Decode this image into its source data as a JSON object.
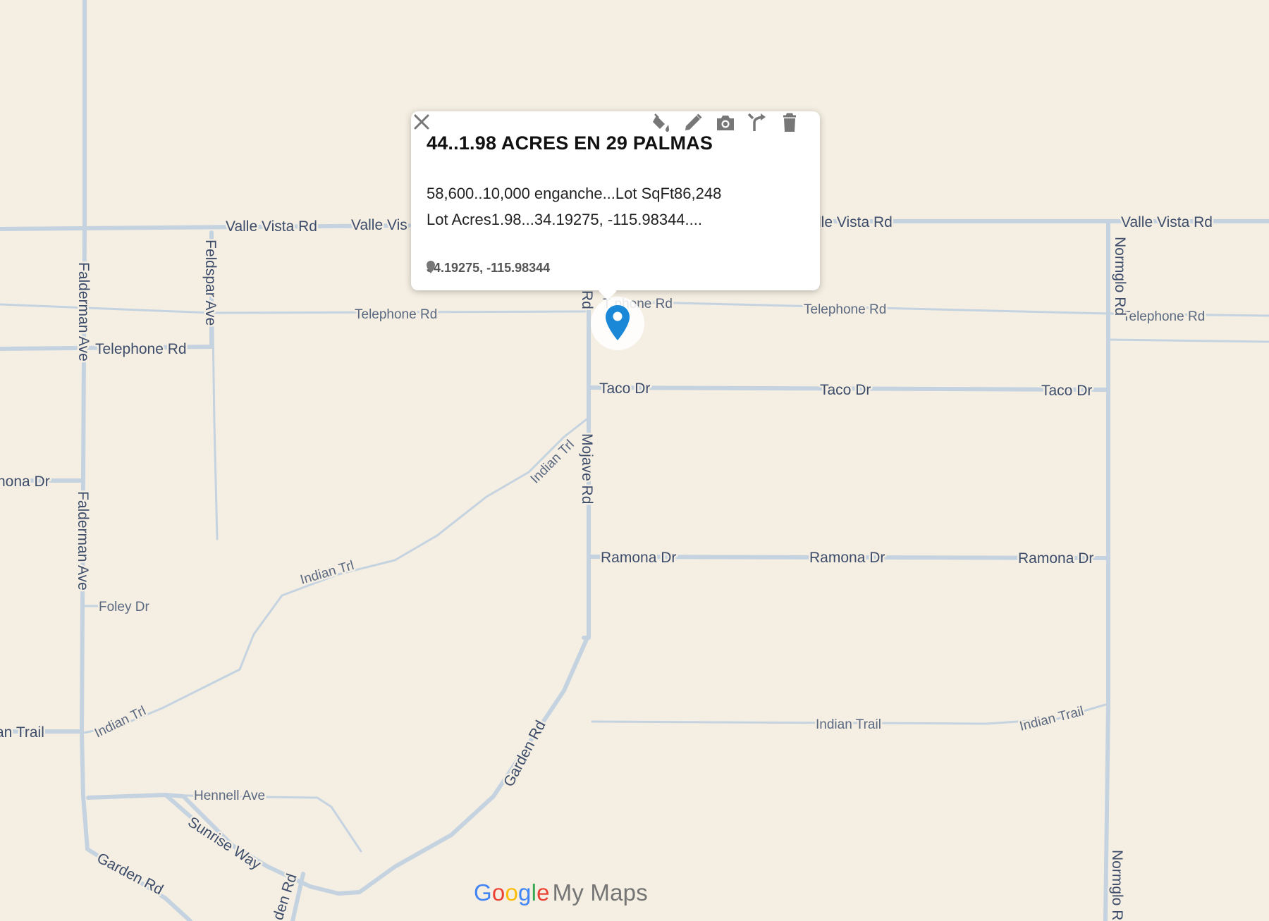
{
  "popup": {
    "title": "44..1.98 ACRES EN 29 PALMAS",
    "description_line1": "58,600..10,000 enganche...Lot SqFt86,248",
    "description_line2": "Lot Acres1.98...34.19275, -115.98344....",
    "coordinates": "34.19275, -115.98344",
    "close_icon": "close-icon",
    "tools": [
      "paint-bucket-icon",
      "edit-pencil-icon",
      "camera-icon",
      "directions-icon",
      "trash-icon"
    ]
  },
  "marker": {
    "color": "#1a88d6",
    "icon": "map-pin-icon"
  },
  "roads": {
    "valle_vista": [
      "Valle Vista Rd",
      "Valle Vis",
      "lle Vista Rd",
      "Valle Vista Rd"
    ],
    "telephone": [
      "Telephone Rd",
      "Telephone Rd",
      "Telephone Rd",
      "Telephone Rd",
      "Telephone Rd"
    ],
    "telephone_partial": "T  phone Rd",
    "taco": [
      "Taco Dr",
      "Taco Dr",
      "Taco Dr"
    ],
    "ramona": [
      "Ramona Dr",
      "Ramona Dr",
      "Ramona Dr"
    ],
    "ramona_partial": "nona Dr",
    "indian_trl": [
      "Indian Trl",
      "Indian Trl",
      "Indian Trl"
    ],
    "indian_trail": [
      "Indian Trail",
      "Indian Trail"
    ],
    "indian_trail_partial": "an Trail",
    "falderman": [
      "Falderman Ave",
      "Falderman Ave"
    ],
    "feldspar": "Feldspar Ave",
    "mojave": "Mojave Rd",
    "mojave_partial": "Rd",
    "foley": "Foley Dr",
    "garden": [
      "Garden Rd",
      "Garden Rd"
    ],
    "garden_partial": "den Rd",
    "hennell": "Hennell Ave",
    "sunrise": "Sunrise Way",
    "normglo": "Normglo Rd",
    "normglo_partial": "Normglo R"
  },
  "brand": {
    "google": [
      "G",
      "o",
      "o",
      "g",
      "l",
      "e"
    ],
    "product": "My Maps"
  },
  "colors": {
    "background": "#f5efe3",
    "road": "#c5d3e0",
    "label": "#3c4c6a"
  }
}
